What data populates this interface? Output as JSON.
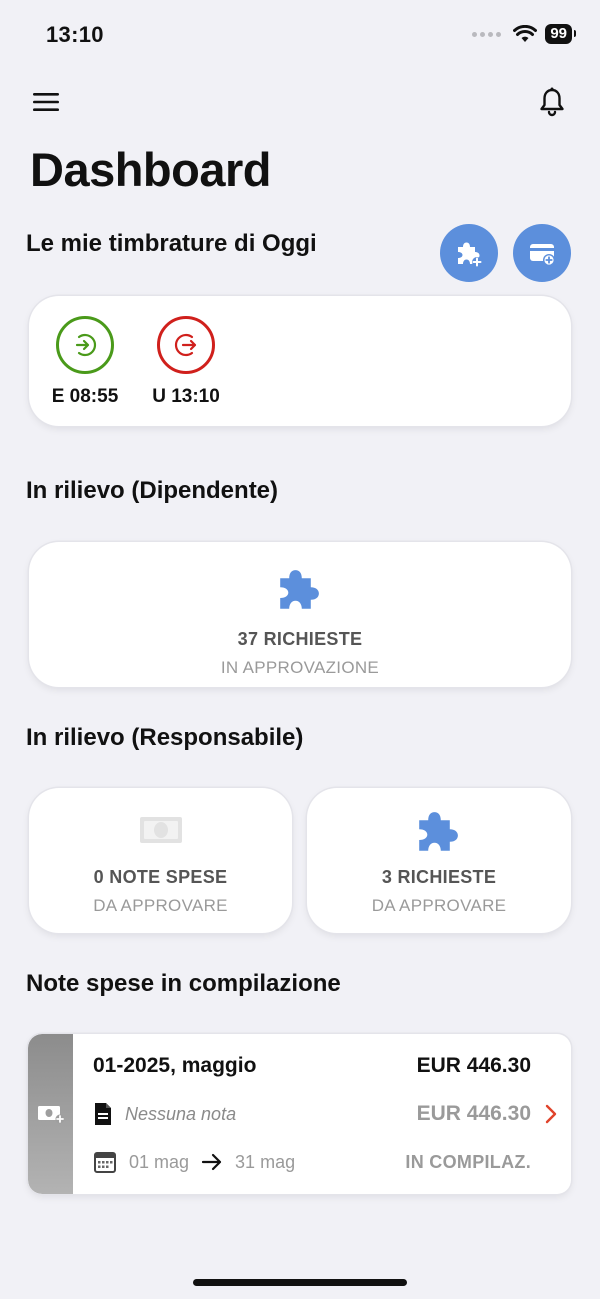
{
  "status_bar": {
    "time": "13:10",
    "battery": "99"
  },
  "header": {
    "title": "Dashboard"
  },
  "timbrature": {
    "title": "Le mie timbrature di Oggi",
    "entries": [
      {
        "label": "E 08:55",
        "type": "entrata",
        "color": "#4a9a1a"
      },
      {
        "label": "U 13:10",
        "type": "uscita",
        "color": "#d0201c"
      }
    ]
  },
  "rilievo_dipendente": {
    "title": "In rilievo (Dipendente)",
    "tile": {
      "count": "37 RICHIESTE",
      "sub": "IN APPROVAZIONE",
      "icon": "puzzle-icon"
    }
  },
  "rilievo_responsabile": {
    "title": "In rilievo (Responsabile)",
    "tiles": [
      {
        "count": "0 NOTE SPESE",
        "sub": "DA APPROVARE",
        "icon": "banknote-icon"
      },
      {
        "count": "3 RICHIESTE",
        "sub": "DA APPROVARE",
        "icon": "puzzle-icon"
      }
    ]
  },
  "note_spese": {
    "title": "Note spese in compilazione",
    "items": [
      {
        "title": "01-2025, maggio",
        "amount": "EUR 446.30",
        "note": "Nessuna nota",
        "amount2": "EUR 446.30",
        "date_from": "01 mag",
        "date_to": "31 mag",
        "status": "IN COMPILAZ."
      }
    ]
  },
  "colors": {
    "accent": "#5c8fdc",
    "background": "#f1f1f6",
    "chevron": "#e0432b"
  }
}
